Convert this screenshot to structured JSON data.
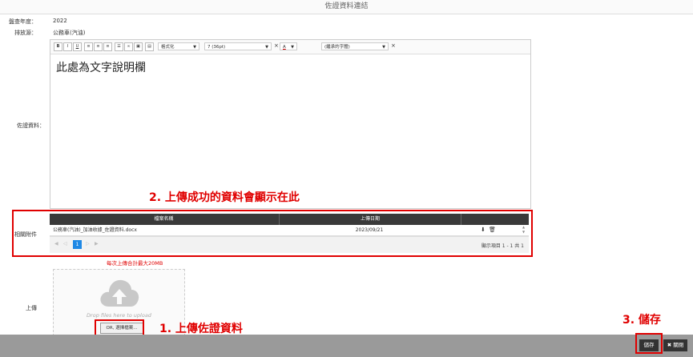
{
  "title": "佐證資料連結",
  "fields": {
    "year_label": "盤查年度：",
    "year_value": "2022",
    "source_label": "排放源：",
    "source_value": "公務車(汽油)",
    "evidence_label": "佐證資料：",
    "attachments_label": "相關附件",
    "upload_label": "上傳"
  },
  "toolbar": {
    "bold": "B",
    "italic": "I",
    "underline": "U",
    "format_select": "格式化",
    "size_select": "7 (36pt)",
    "font_select": "(繼承的字體)",
    "clear": "×",
    "color_a": "A"
  },
  "editor_text": "此處為文字說明欄",
  "annotations": {
    "step1": "1. 上傳佐證資料",
    "step2": "2. 上傳成功的資料會顯示在此",
    "step3": "3. 儲存"
  },
  "table": {
    "headers": [
      "檔案名稱",
      "上傳日期"
    ],
    "rows": [
      {
        "filename": "公務車(汽油)_加油收據_佐證資料.docx",
        "date": "2023/09/21"
      }
    ],
    "page": "1",
    "summary": "顯示項目 1 - 1 共 1"
  },
  "upload_limit": "每次上傳合計最大20MB",
  "dropzone": {
    "hint": "Drop files here to upload",
    "button": "OR, 選擇檔案..."
  },
  "footer": {
    "save": "儲存",
    "close": "關閉"
  },
  "colors": {
    "annotation": "#e00000",
    "table_header": "#3a3a3a",
    "page_active": "#1e88e5"
  }
}
